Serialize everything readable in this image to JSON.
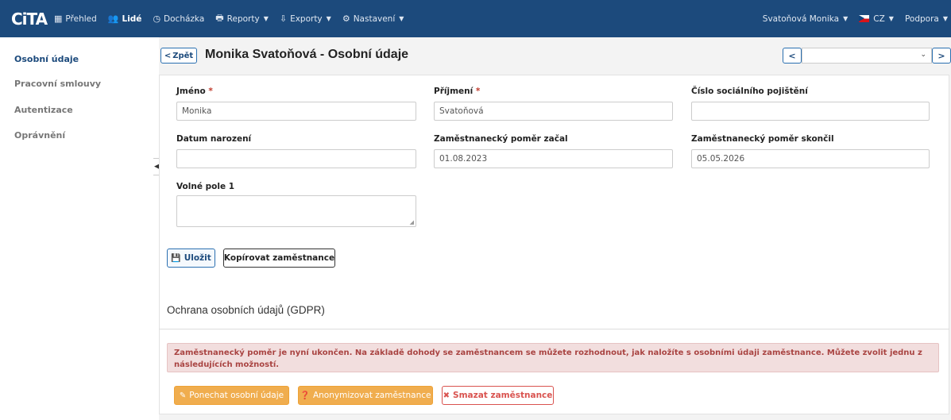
{
  "navbar": {
    "logo": "CiTA",
    "items": [
      {
        "label": "Přehled",
        "icon": "grid-icon",
        "glyph": "▦",
        "caret": false,
        "active": false
      },
      {
        "label": "Lidé",
        "icon": "users-icon",
        "glyph": "👥",
        "caret": false,
        "active": true
      },
      {
        "label": "Docházka",
        "icon": "clock-icon",
        "glyph": "◷",
        "caret": false,
        "active": false
      },
      {
        "label": "Reporty",
        "icon": "print-icon",
        "glyph": "🖶",
        "caret": true,
        "active": false
      },
      {
        "label": "Exporty",
        "icon": "export-icon",
        "glyph": "⇩",
        "caret": true,
        "active": false
      },
      {
        "label": "Nastavení",
        "icon": "gear-icon",
        "glyph": "⚙",
        "caret": true,
        "active": false
      }
    ],
    "user": "Svatoňová Monika",
    "language": "CZ",
    "support": "Podpora"
  },
  "sidebar": {
    "items": [
      {
        "label": "Osobní údaje",
        "active": true
      },
      {
        "label": "Pracovní smlouvy",
        "active": false
      },
      {
        "label": "Autentizace",
        "active": false
      },
      {
        "label": "Oprávnění",
        "active": false
      }
    ]
  },
  "header": {
    "back_label": "Zpět",
    "title": "Monika Svatoňová - Osobní údaje",
    "select_value": ""
  },
  "form": {
    "first_name": {
      "label": "Jméno",
      "value": "Monika",
      "required": "*"
    },
    "last_name": {
      "label": "Příjmení",
      "value": "Svatoňová",
      "required": "*"
    },
    "ssn": {
      "label": "Číslo sociálního pojištění",
      "value": ""
    },
    "birth_date": {
      "label": "Datum narození",
      "value": ""
    },
    "employment_start": {
      "label": "Zaměstnanecký poměr začal",
      "value": "01.08.2023"
    },
    "employment_end": {
      "label": "Zaměstnanecký poměr skončil",
      "value": "05.05.2026"
    },
    "free_field": {
      "label": "Volné pole 1",
      "value": ""
    },
    "save_label": "Uložit",
    "copy_label": "Kopírovat zaměstnance"
  },
  "gdpr": {
    "title": "Ochrana osobních údajů (GDPR)",
    "alert": "Zaměstnanecký poměr je nyní ukončen. Na základě dohody se zaměstnancem se můžete rozhodnout, jak naložíte s osobními údaji zaměstnance. Můžete zvolit jednu z následujících možností.",
    "keep_label": "Ponechat osobní údaje",
    "anonymize_label": "Anonymizovat zaměstnance",
    "delete_label": "Smazat zaměstnance"
  },
  "colors": {
    "navbar_bg": "#1c4a7c",
    "accent": "#2a6fb0",
    "warning": "#f0ad4e",
    "danger": "#d9534f",
    "alert_bg": "#f2dede"
  }
}
